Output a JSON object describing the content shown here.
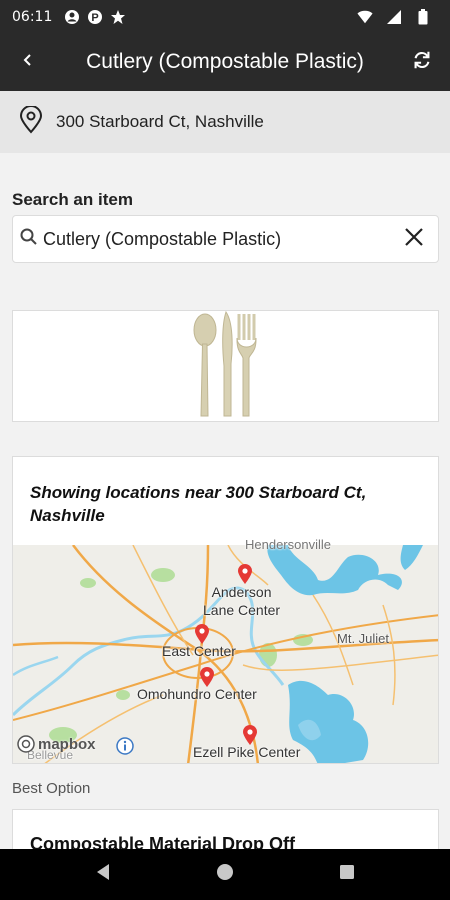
{
  "status": {
    "time": "06:11",
    "icons": [
      "account-icon",
      "parking-icon",
      "star-icon",
      "wifi-icon",
      "signal-icon",
      "battery-icon"
    ]
  },
  "app_bar": {
    "title": "Cutlery (Compostable Plastic)",
    "back_icon": "back-arrow-icon",
    "refresh_icon": "refresh-icon"
  },
  "location": {
    "address": "300 Starboard Ct, Nashville",
    "icon": "location-pin-icon"
  },
  "search": {
    "label": "Search an item",
    "value": "Cutlery (Compostable Plastic)",
    "clear_icon": "close-icon"
  },
  "item": {
    "image": "cutlery-image"
  },
  "map_card": {
    "heading": "Showing locations near 300 Starboard Ct, Nashville",
    "labels": {
      "hendersonville": "Hendersonville",
      "anderson": "Anderson\nLane Center",
      "mt_juliet": "Mt. Juliet",
      "east": "East Center",
      "omohundro": "Omohundro Center",
      "ezell": "Ezell Pike Center",
      "bellevue": "Bellevue",
      "mapbox": "mapbox"
    }
  },
  "results": {
    "best_option_label": "Best Option",
    "first_title": "Compostable Material Drop Off"
  },
  "colors": {
    "app_bar": "#2a2a2a",
    "pin": "#e53935",
    "water": "#6cc4e6",
    "road": "#f0a848",
    "park": "#b7dfa0"
  }
}
